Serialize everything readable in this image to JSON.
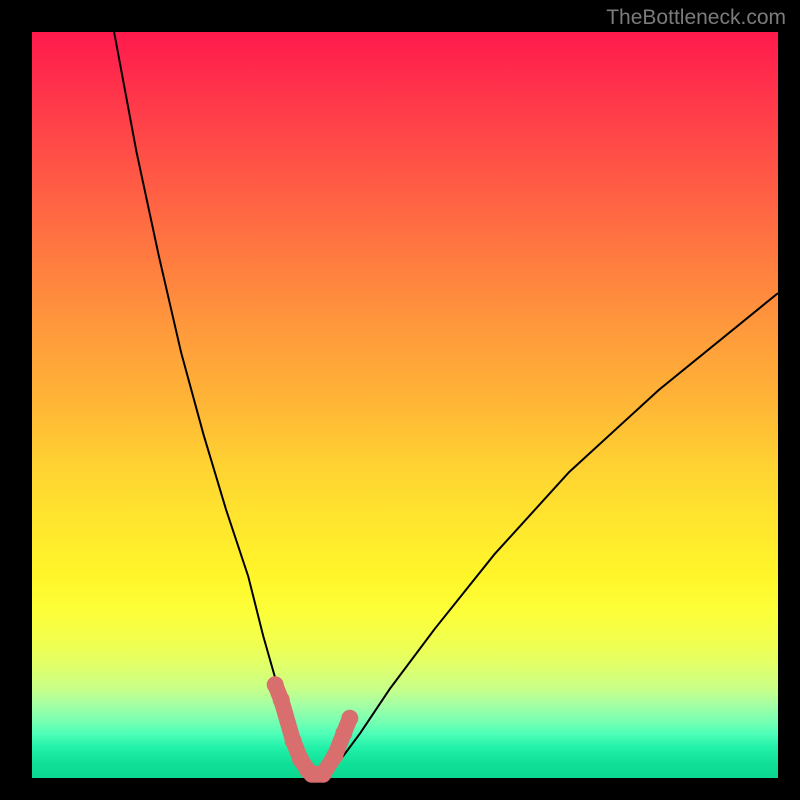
{
  "watermark": "TheBottleneck.com",
  "colors": {
    "page_bg": "#000000",
    "curve_stroke": "#000000",
    "marker_fill": "#d96e6e",
    "watermark": "#7b7b7b"
  },
  "chart_data": {
    "type": "line",
    "title": "",
    "xlabel": "",
    "ylabel": "",
    "xlim": [
      0,
      100
    ],
    "ylim": [
      0,
      100
    ],
    "series": [
      {
        "name": "left-branch",
        "x": [
          11,
          14,
          17,
          20,
          23,
          26,
          29,
          31,
          33,
          34.5,
          36,
          37,
          37.5
        ],
        "y": [
          100,
          84,
          70,
          57,
          46,
          36,
          27,
          19,
          12,
          7,
          3,
          1,
          0
        ]
      },
      {
        "name": "right-branch",
        "x": [
          39,
          41,
          44,
          48,
          54,
          62,
          72,
          84,
          100
        ],
        "y": [
          0,
          2,
          6,
          12,
          20,
          30,
          41,
          52,
          65
        ]
      },
      {
        "name": "bottom-trough",
        "x": [
          37.5,
          38,
          38.5,
          39
        ],
        "y": [
          0,
          0,
          0,
          0
        ]
      }
    ],
    "markers": {
      "x": [
        32.6,
        33.4,
        35.0,
        36.0,
        37.0,
        37.5,
        38.0,
        38.5,
        39.0,
        40.6,
        41.8,
        42.6
      ],
      "y": [
        12.5,
        10.5,
        5.0,
        2.5,
        1.0,
        0.5,
        0.5,
        0.5,
        0.5,
        3.0,
        6.0,
        8.0
      ],
      "r": 8
    },
    "gradient_stops": [
      {
        "pct": 0,
        "color": "#ff1a4d"
      },
      {
        "pct": 50,
        "color": "#ffb636"
      },
      {
        "pct": 78,
        "color": "#fcff3a"
      },
      {
        "pct": 100,
        "color": "#0ad890"
      }
    ]
  }
}
